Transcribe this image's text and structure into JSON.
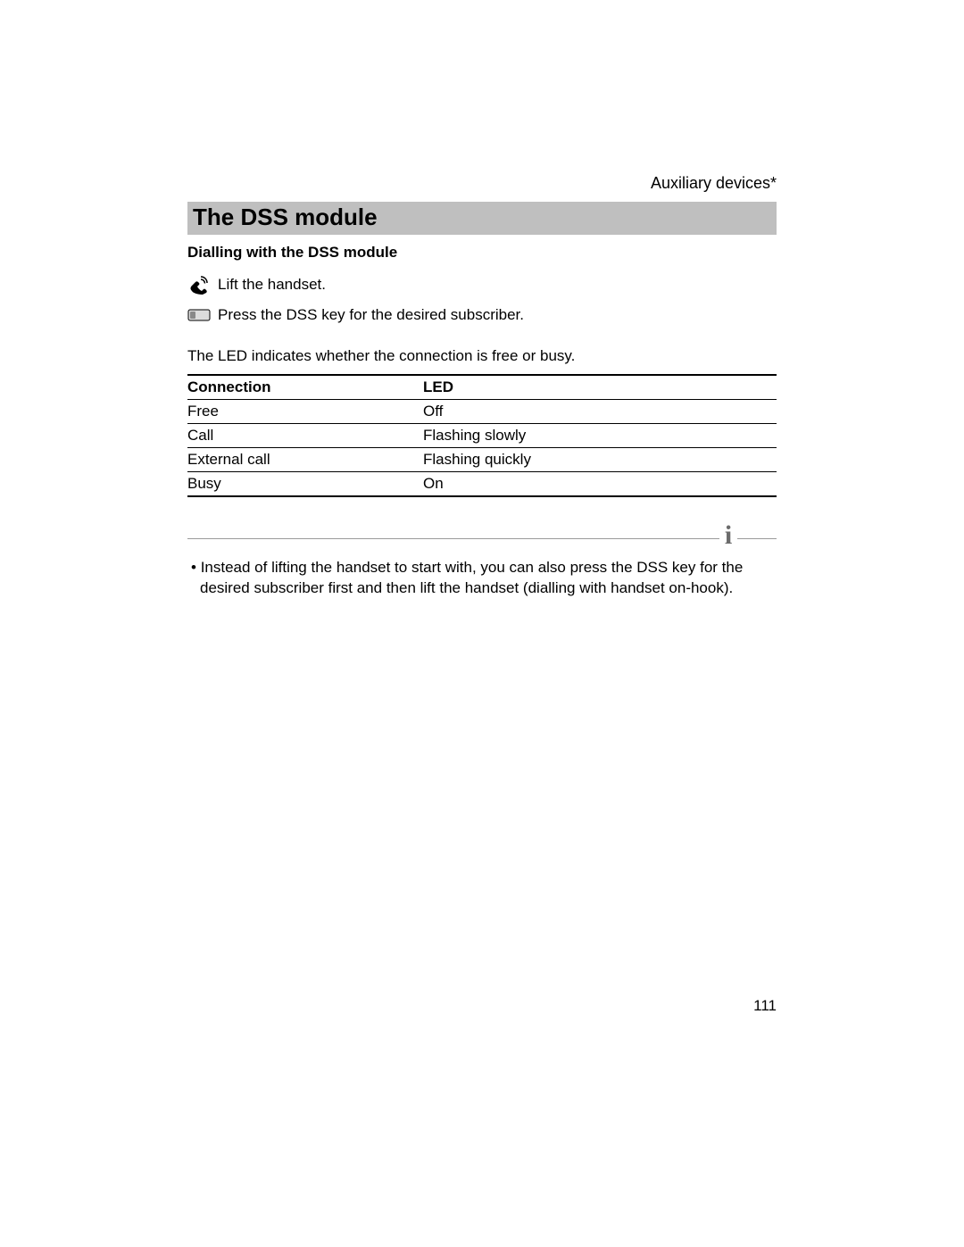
{
  "header": {
    "section_label": "Auxiliary devices*"
  },
  "title": "The DSS module",
  "subheading": "Dialling with the DSS module",
  "steps": [
    {
      "icon": "handset-icon",
      "text": "Lift the handset."
    },
    {
      "icon": "key-icon",
      "text": "Press the DSS key for the desired subscriber."
    }
  ],
  "led_intro": "The LED indicates whether the connection is free or busy.",
  "table": {
    "headers": [
      "Connection",
      "LED"
    ],
    "rows": [
      [
        "Free",
        "Off"
      ],
      [
        "Call",
        "Flashing slowly"
      ],
      [
        "External call",
        "Flashing quickly"
      ],
      [
        "Busy",
        "On"
      ]
    ]
  },
  "info_icon_label": "i",
  "note": "Instead of lifting the handset to start with, you can also press the DSS key for the desired subscriber first and then lift the handset (dialling with handset on-hook).",
  "page_number": "111"
}
